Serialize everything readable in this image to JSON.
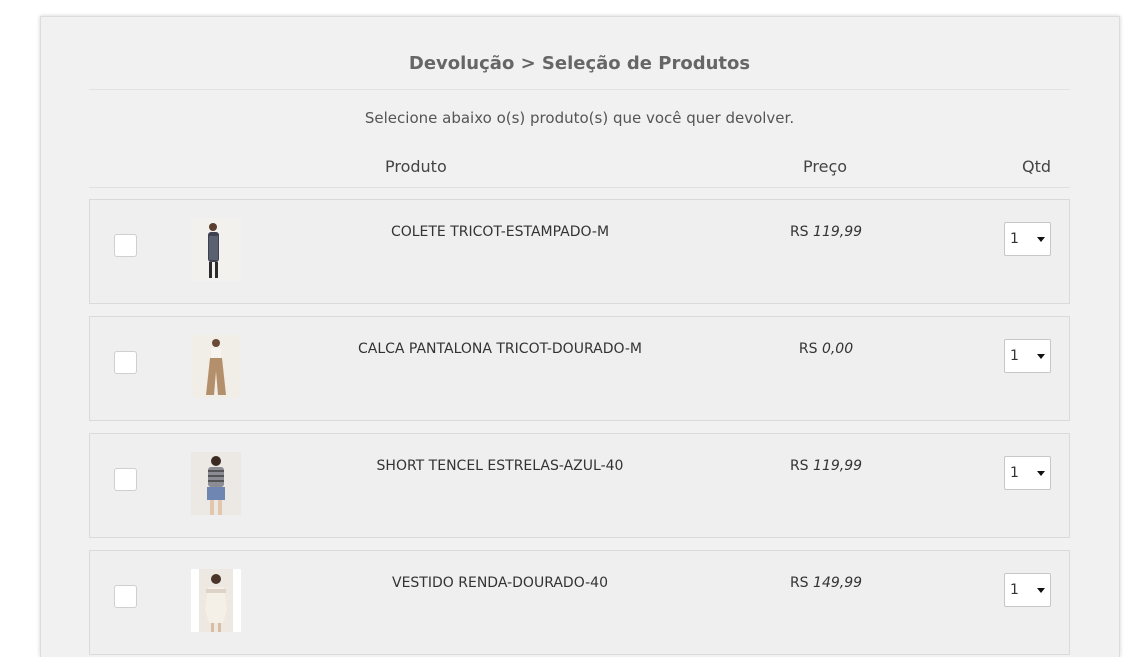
{
  "page": {
    "title": "Devolução > Seleção de Produtos",
    "subtitle": "Selecione abaixo o(s) produto(s) que você quer devolver."
  },
  "table": {
    "headers": {
      "product": "Produto",
      "price": "Preço",
      "qty": "Qtd"
    },
    "currency": "RS",
    "rows": [
      {
        "name": "COLETE TRICOT-ESTAMPADO-M",
        "currency": "RS",
        "price": "119,99",
        "qty": "1",
        "checked": false
      },
      {
        "name": "CALCA PANTALONA TRICOT-DOURADO-M",
        "currency": "RS",
        "price": "0,00",
        "qty": "1",
        "checked": false
      },
      {
        "name": "SHORT TENCEL ESTRELAS-AZUL-40",
        "currency": "RS",
        "price": "119,99",
        "qty": "1",
        "checked": false
      },
      {
        "name": "VESTIDO RENDA-DOURADO-40",
        "currency": "RS",
        "price": "149,99",
        "qty": "1",
        "checked": false
      }
    ]
  },
  "colors": {
    "panel_bg": "#f1f1f1",
    "row_bg": "#efefef",
    "title": "#666666",
    "text": "#333333"
  },
  "icons": {
    "qty_dropdown": "caret-down-icon"
  }
}
